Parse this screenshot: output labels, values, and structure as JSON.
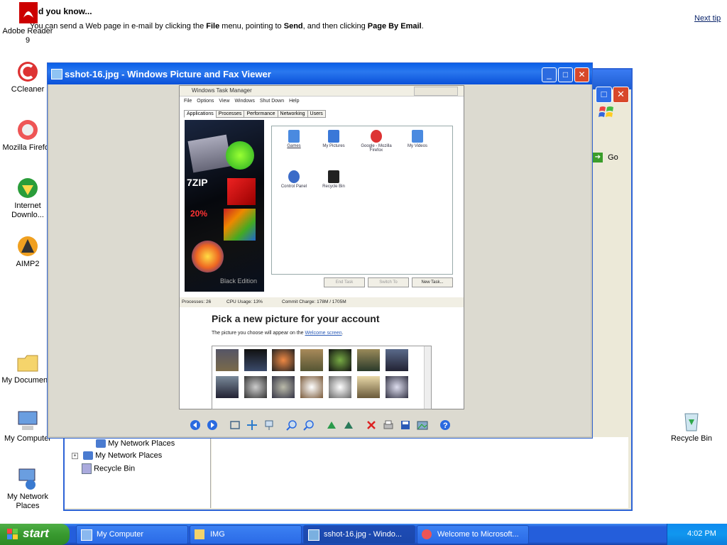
{
  "desktop": {
    "tip": {
      "title": "Did you know...",
      "body_prefix": "You can send a Web page in e-mail by clicking the ",
      "file": "File",
      "mid1": " menu, pointing to ",
      "send": "Send",
      "mid2": ", and then clicking ",
      "pbe": "Page By Email",
      "end": ".",
      "next": "Next tip"
    },
    "icons": [
      {
        "label": "Adobe Reader 9"
      },
      {
        "label": "CCleaner"
      },
      {
        "label": "Mozilla Firefox"
      },
      {
        "label": "Internet Downlo..."
      },
      {
        "label": "AIMP2"
      },
      {
        "label": "My Documents"
      },
      {
        "label": "My Computer"
      },
      {
        "label": "My Network Places"
      },
      {
        "label": "Recycle Bin"
      }
    ]
  },
  "background_window": {
    "go_label": "Go",
    "tree_items": [
      "My Network Places",
      "My Network Places",
      "Recycle Bin"
    ]
  },
  "viewer": {
    "title": "sshot-16.jpg - Windows Picture and Fax Viewer",
    "screenshot": {
      "taskmanager": {
        "title": "Windows Task Manager",
        "menu": [
          "File",
          "Options",
          "View",
          "Windows",
          "Shut Down",
          "Help"
        ],
        "tabs": [
          "Applications",
          "Processes",
          "Performance",
          "Networking",
          "Users"
        ],
        "apps": [
          "Games",
          "My Pictures",
          "Google - Mozilla Firefox",
          "My Videos",
          "Control Panel",
          "Recycle Bin"
        ],
        "buttons": [
          "End Task",
          "Switch To",
          "New Task..."
        ],
        "status": {
          "processes": "Processes: 26",
          "cpu": "CPU Usage: 13%",
          "commit": "Commit Charge: 178M / 1705M"
        },
        "art_text": [
          "7ZIP",
          "20%",
          "Black Edition"
        ]
      },
      "account": {
        "title": "Pick a new picture for your account",
        "sub_prefix": "The picture you choose will appear on the ",
        "sub_link": "Welcome screen",
        "sub_end": "."
      }
    }
  },
  "taskbar": {
    "start": "start",
    "tasks": [
      {
        "label": "My Computer"
      },
      {
        "label": "IMG"
      },
      {
        "label": "sshot-16.jpg - Windo..."
      },
      {
        "label": "Welcome to Microsoft..."
      }
    ],
    "clock": "4:02 PM"
  }
}
